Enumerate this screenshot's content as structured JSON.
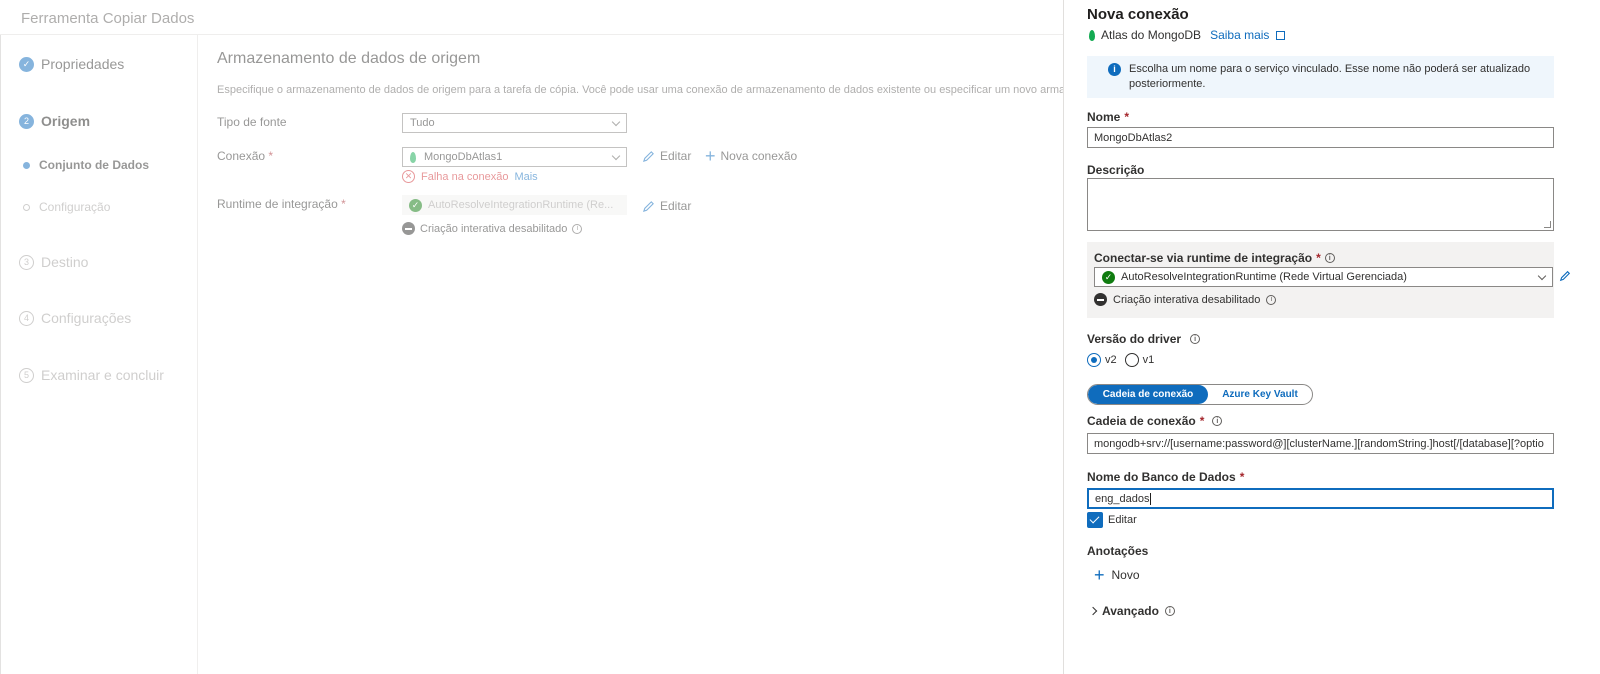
{
  "wizard": {
    "title": "Ferramenta Copiar Dados",
    "steps": [
      {
        "number": "✓",
        "label": "Propriedades"
      },
      {
        "number": "2",
        "label": "Origem"
      },
      {
        "number": "3",
        "label": "Destino"
      },
      {
        "number": "4",
        "label": "Configurações"
      },
      {
        "number": "5",
        "label": "Examinar e concluir"
      }
    ],
    "substeps": [
      "Conjunto de Dados",
      "Configuração"
    ],
    "main": {
      "title": "Armazenamento de dados de origem",
      "description": "Especifique o armazenamento de dados de origem para a tarefa de cópia. Você pode usar uma conexão de armazenamento de dados existente ou especificar um novo arma",
      "source_type_label": "Tipo de fonte",
      "source_type_value": "Tudo",
      "connection_label": "Conexão",
      "connection_value": "MongoDbAtlas1",
      "edit_label": "Editar",
      "new_connection_label": "Nova conexão",
      "error_text": "Falha na conexão",
      "more_link": "Mais",
      "runtime_label": "Runtime de integração",
      "runtime_value": "AutoResolveIntegrationRuntime (Re...",
      "runtime_edit_label": "Editar",
      "interactive_text": "Criação interativa desabilitado"
    }
  },
  "panel": {
    "title": "Nova conexão",
    "subtitle": "Atlas do MongoDB",
    "learn_more": "Saiba mais",
    "info_message": "Escolha um nome para o serviço vinculado. Esse nome não poderá ser atualizado posteriormente.",
    "name_label": "Nome",
    "name_value": "MongoDbAtlas2",
    "description_label": "Descrição",
    "runtime_label": "Conectar-se via runtime de integração",
    "runtime_value": "AutoResolveIntegrationRuntime (Rede Virtual Gerenciada)",
    "interactive_text": "Criação interativa desabilitado",
    "driver_label": "Versão do driver",
    "driver_options": [
      "v2",
      "v1"
    ],
    "driver_selected": "v2",
    "toggle_options": [
      "Cadeia de conexão",
      "Azure Key Vault"
    ],
    "conn_string_label": "Cadeia de conexão",
    "conn_string_value": "mongodb+srv://[username:password@][clusterName.][randomString.]host[/[database][?optio",
    "db_name_label": "Nome do Banco de Dados",
    "db_name_value": "eng_dados",
    "edit_checkbox_label": "Editar",
    "annotations_label": "Anotações",
    "new_label": "Novo",
    "advanced_label": "Avançado",
    "required_mark": "*"
  },
  "colors": {
    "accent": "#0f6cbd",
    "error": "#d13438",
    "success": "#107c10",
    "required": "#a4262c",
    "info_bg": "#eff6fc"
  }
}
